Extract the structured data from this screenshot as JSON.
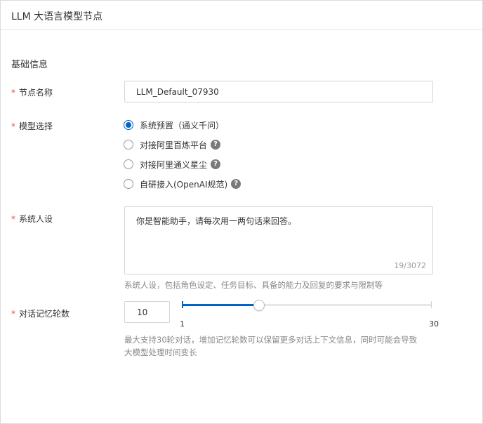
{
  "header": {
    "title": "LLM 大语言模型节点"
  },
  "section": {
    "title": "基础信息"
  },
  "node_name": {
    "required_mark": "*",
    "label": "节点名称",
    "value": "LLM_Default_07930"
  },
  "model_select": {
    "required_mark": "*",
    "label": "模型选择",
    "selected_index": 0,
    "options": [
      {
        "label": "系统预置（通义千问）",
        "help": false
      },
      {
        "label": "对接阿里百炼平台",
        "help": true
      },
      {
        "label": "对接阿里通义星尘",
        "help": true
      },
      {
        "label": "自研接入(OpenAI规范)",
        "help": true
      }
    ]
  },
  "persona": {
    "required_mark": "*",
    "label": "系统人设",
    "value": "你是智能助手，请每次用一两句话来回答。",
    "counter": "19/3072",
    "hint": "系统人设，包括角色设定、任务目标、具备的能力及回复的要求与限制等"
  },
  "memory": {
    "required_mark": "*",
    "label": "对话记忆轮数",
    "value": "10",
    "min_label": "1",
    "max_label": "30",
    "min": 1,
    "max": 30,
    "current": 10,
    "hint_line1": "最大支持30轮对话，增加记忆轮数可以保留更多对话上下文信息，同时可能会导致",
    "hint_line2": "大模型处理时间变长"
  },
  "colors": {
    "accent": "#0064c8",
    "required": "#e64c4c",
    "hint": "#888888"
  },
  "icons": {
    "help": "question-circle-icon"
  }
}
